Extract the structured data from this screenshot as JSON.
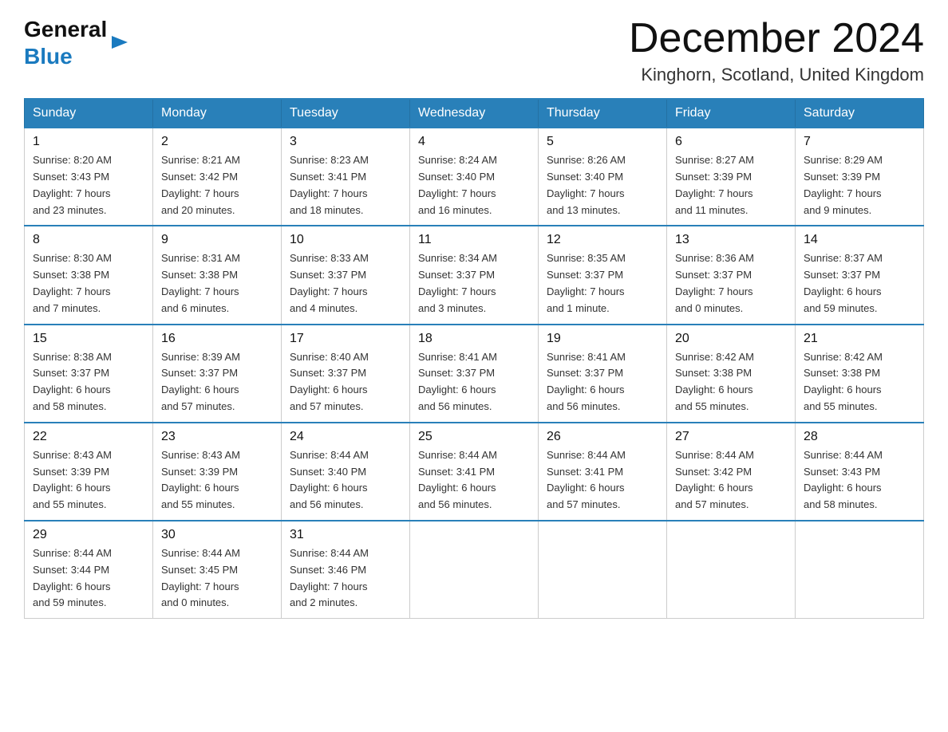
{
  "header": {
    "logo_general": "General",
    "logo_blue": "Blue",
    "month_title": "December 2024",
    "location": "Kinghorn, Scotland, United Kingdom"
  },
  "days_of_week": [
    "Sunday",
    "Monday",
    "Tuesday",
    "Wednesday",
    "Thursday",
    "Friday",
    "Saturday"
  ],
  "weeks": [
    [
      {
        "day": "1",
        "sunrise": "Sunrise: 8:20 AM",
        "sunset": "Sunset: 3:43 PM",
        "daylight": "Daylight: 7 hours",
        "daylight2": "and 23 minutes."
      },
      {
        "day": "2",
        "sunrise": "Sunrise: 8:21 AM",
        "sunset": "Sunset: 3:42 PM",
        "daylight": "Daylight: 7 hours",
        "daylight2": "and 20 minutes."
      },
      {
        "day": "3",
        "sunrise": "Sunrise: 8:23 AM",
        "sunset": "Sunset: 3:41 PM",
        "daylight": "Daylight: 7 hours",
        "daylight2": "and 18 minutes."
      },
      {
        "day": "4",
        "sunrise": "Sunrise: 8:24 AM",
        "sunset": "Sunset: 3:40 PM",
        "daylight": "Daylight: 7 hours",
        "daylight2": "and 16 minutes."
      },
      {
        "day": "5",
        "sunrise": "Sunrise: 8:26 AM",
        "sunset": "Sunset: 3:40 PM",
        "daylight": "Daylight: 7 hours",
        "daylight2": "and 13 minutes."
      },
      {
        "day": "6",
        "sunrise": "Sunrise: 8:27 AM",
        "sunset": "Sunset: 3:39 PM",
        "daylight": "Daylight: 7 hours",
        "daylight2": "and 11 minutes."
      },
      {
        "day": "7",
        "sunrise": "Sunrise: 8:29 AM",
        "sunset": "Sunset: 3:39 PM",
        "daylight": "Daylight: 7 hours",
        "daylight2": "and 9 minutes."
      }
    ],
    [
      {
        "day": "8",
        "sunrise": "Sunrise: 8:30 AM",
        "sunset": "Sunset: 3:38 PM",
        "daylight": "Daylight: 7 hours",
        "daylight2": "and 7 minutes."
      },
      {
        "day": "9",
        "sunrise": "Sunrise: 8:31 AM",
        "sunset": "Sunset: 3:38 PM",
        "daylight": "Daylight: 7 hours",
        "daylight2": "and 6 minutes."
      },
      {
        "day": "10",
        "sunrise": "Sunrise: 8:33 AM",
        "sunset": "Sunset: 3:37 PM",
        "daylight": "Daylight: 7 hours",
        "daylight2": "and 4 minutes."
      },
      {
        "day": "11",
        "sunrise": "Sunrise: 8:34 AM",
        "sunset": "Sunset: 3:37 PM",
        "daylight": "Daylight: 7 hours",
        "daylight2": "and 3 minutes."
      },
      {
        "day": "12",
        "sunrise": "Sunrise: 8:35 AM",
        "sunset": "Sunset: 3:37 PM",
        "daylight": "Daylight: 7 hours",
        "daylight2": "and 1 minute."
      },
      {
        "day": "13",
        "sunrise": "Sunrise: 8:36 AM",
        "sunset": "Sunset: 3:37 PM",
        "daylight": "Daylight: 7 hours",
        "daylight2": "and 0 minutes."
      },
      {
        "day": "14",
        "sunrise": "Sunrise: 8:37 AM",
        "sunset": "Sunset: 3:37 PM",
        "daylight": "Daylight: 6 hours",
        "daylight2": "and 59 minutes."
      }
    ],
    [
      {
        "day": "15",
        "sunrise": "Sunrise: 8:38 AM",
        "sunset": "Sunset: 3:37 PM",
        "daylight": "Daylight: 6 hours",
        "daylight2": "and 58 minutes."
      },
      {
        "day": "16",
        "sunrise": "Sunrise: 8:39 AM",
        "sunset": "Sunset: 3:37 PM",
        "daylight": "Daylight: 6 hours",
        "daylight2": "and 57 minutes."
      },
      {
        "day": "17",
        "sunrise": "Sunrise: 8:40 AM",
        "sunset": "Sunset: 3:37 PM",
        "daylight": "Daylight: 6 hours",
        "daylight2": "and 57 minutes."
      },
      {
        "day": "18",
        "sunrise": "Sunrise: 8:41 AM",
        "sunset": "Sunset: 3:37 PM",
        "daylight": "Daylight: 6 hours",
        "daylight2": "and 56 minutes."
      },
      {
        "day": "19",
        "sunrise": "Sunrise: 8:41 AM",
        "sunset": "Sunset: 3:37 PM",
        "daylight": "Daylight: 6 hours",
        "daylight2": "and 56 minutes."
      },
      {
        "day": "20",
        "sunrise": "Sunrise: 8:42 AM",
        "sunset": "Sunset: 3:38 PM",
        "daylight": "Daylight: 6 hours",
        "daylight2": "and 55 minutes."
      },
      {
        "day": "21",
        "sunrise": "Sunrise: 8:42 AM",
        "sunset": "Sunset: 3:38 PM",
        "daylight": "Daylight: 6 hours",
        "daylight2": "and 55 minutes."
      }
    ],
    [
      {
        "day": "22",
        "sunrise": "Sunrise: 8:43 AM",
        "sunset": "Sunset: 3:39 PM",
        "daylight": "Daylight: 6 hours",
        "daylight2": "and 55 minutes."
      },
      {
        "day": "23",
        "sunrise": "Sunrise: 8:43 AM",
        "sunset": "Sunset: 3:39 PM",
        "daylight": "Daylight: 6 hours",
        "daylight2": "and 55 minutes."
      },
      {
        "day": "24",
        "sunrise": "Sunrise: 8:44 AM",
        "sunset": "Sunset: 3:40 PM",
        "daylight": "Daylight: 6 hours",
        "daylight2": "and 56 minutes."
      },
      {
        "day": "25",
        "sunrise": "Sunrise: 8:44 AM",
        "sunset": "Sunset: 3:41 PM",
        "daylight": "Daylight: 6 hours",
        "daylight2": "and 56 minutes."
      },
      {
        "day": "26",
        "sunrise": "Sunrise: 8:44 AM",
        "sunset": "Sunset: 3:41 PM",
        "daylight": "Daylight: 6 hours",
        "daylight2": "and 57 minutes."
      },
      {
        "day": "27",
        "sunrise": "Sunrise: 8:44 AM",
        "sunset": "Sunset: 3:42 PM",
        "daylight": "Daylight: 6 hours",
        "daylight2": "and 57 minutes."
      },
      {
        "day": "28",
        "sunrise": "Sunrise: 8:44 AM",
        "sunset": "Sunset: 3:43 PM",
        "daylight": "Daylight: 6 hours",
        "daylight2": "and 58 minutes."
      }
    ],
    [
      {
        "day": "29",
        "sunrise": "Sunrise: 8:44 AM",
        "sunset": "Sunset: 3:44 PM",
        "daylight": "Daylight: 6 hours",
        "daylight2": "and 59 minutes."
      },
      {
        "day": "30",
        "sunrise": "Sunrise: 8:44 AM",
        "sunset": "Sunset: 3:45 PM",
        "daylight": "Daylight: 7 hours",
        "daylight2": "and 0 minutes."
      },
      {
        "day": "31",
        "sunrise": "Sunrise: 8:44 AM",
        "sunset": "Sunset: 3:46 PM",
        "daylight": "Daylight: 7 hours",
        "daylight2": "and 2 minutes."
      },
      null,
      null,
      null,
      null
    ]
  ]
}
